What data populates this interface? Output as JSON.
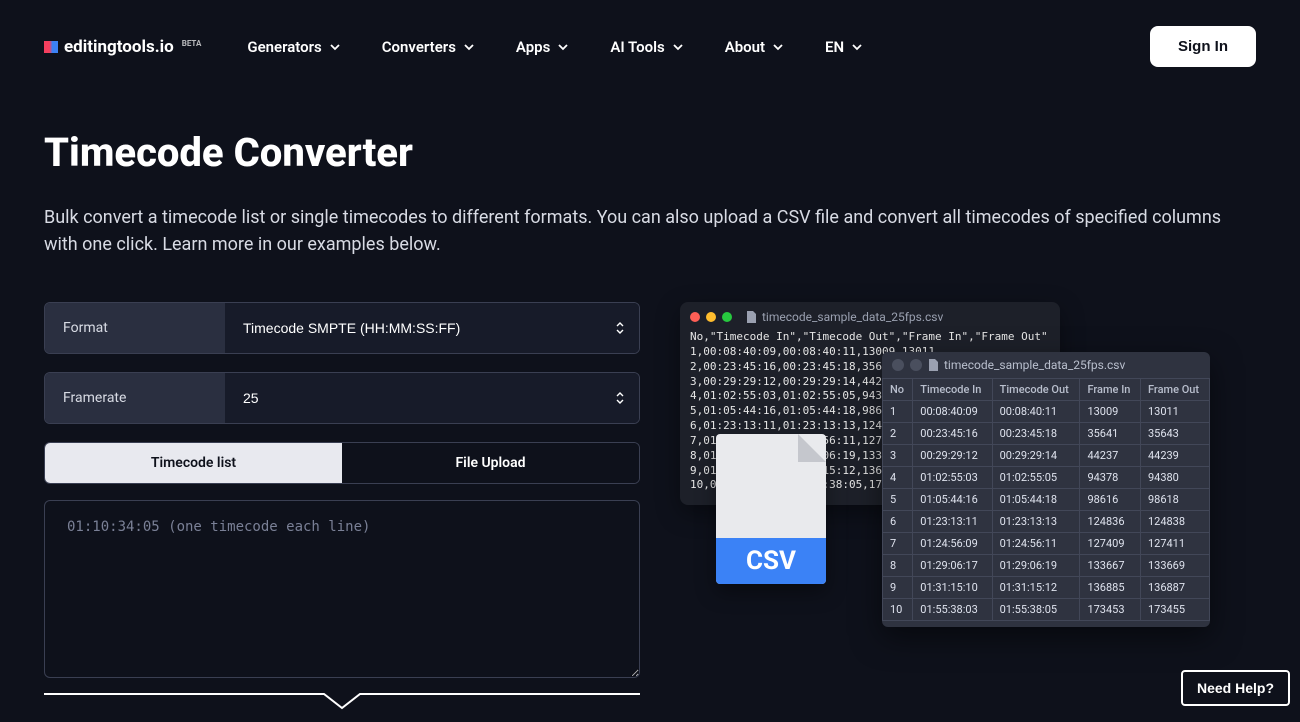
{
  "brand": {
    "name": "editingtools.io",
    "badge": "BETA"
  },
  "nav": {
    "items": [
      "Generators",
      "Converters",
      "Apps",
      "AI Tools",
      "About",
      "EN"
    ]
  },
  "auth": {
    "signin": "Sign In"
  },
  "page": {
    "title": "Timecode Converter",
    "description": "Bulk convert a timecode list or single timecodes to different formats. You can also upload a CSV file and convert all timecodes of specified columns with one click. Learn more in our examples below."
  },
  "form": {
    "format_label": "Format",
    "format_value": "Timecode SMPTE (HH:MM:SS:FF)",
    "framerate_label": "Framerate",
    "framerate_value": "25",
    "tabs": {
      "list": "Timecode list",
      "upload": "File Upload"
    },
    "textarea_placeholder": "01:10:34:05 (one timecode each line)"
  },
  "terminal": {
    "filename": "timecode_sample_data_25fps.csv",
    "content": "No,\"Timecode In\",\"Timecode Out\",\"Frame In\",\"Frame Out\"\n1,00:08:40:09,00:08:40:11,13009,13011\n2,00:23:45:16,00:23:45:18,35641,35643\n3,00:29:29:12,00:29:29:14,44237,44239\n4,01:02:55:03,01:02:55:05,94378,94380\n5,01:05:44:16,01:05:44:18,98616,98618\n6,01:23:13:11,01:23:13:13,124836\n7,01:24:56:09,01:24:56:11,127409\n8,01:29:06:17,01:29:06:19,133667\n9,01:31:15:10,01:31:15:12,136885\n10,01:55:38:03,01:55:38:05,173453"
  },
  "csv_icon": {
    "label": "CSV"
  },
  "table": {
    "filename": "timecode_sample_data_25fps.csv",
    "headers": [
      "No",
      "Timecode In",
      "Timecode Out",
      "Frame In",
      "Frame Out"
    ],
    "rows": [
      [
        "1",
        "00:08:40:09",
        "00:08:40:11",
        "13009",
        "13011"
      ],
      [
        "2",
        "00:23:45:16",
        "00:23:45:18",
        "35641",
        "35643"
      ],
      [
        "3",
        "00:29:29:12",
        "00:29:29:14",
        "44237",
        "44239"
      ],
      [
        "4",
        "01:02:55:03",
        "01:02:55:05",
        "94378",
        "94380"
      ],
      [
        "5",
        "01:05:44:16",
        "01:05:44:18",
        "98616",
        "98618"
      ],
      [
        "6",
        "01:23:13:11",
        "01:23:13:13",
        "124836",
        "124838"
      ],
      [
        "7",
        "01:24:56:09",
        "01:24:56:11",
        "127409",
        "127411"
      ],
      [
        "8",
        "01:29:06:17",
        "01:29:06:19",
        "133667",
        "133669"
      ],
      [
        "9",
        "01:31:15:10",
        "01:31:15:12",
        "136885",
        "136887"
      ],
      [
        "10",
        "01:55:38:03",
        "01:55:38:05",
        "173453",
        "173455"
      ]
    ]
  },
  "help": {
    "label": "Need Help?"
  }
}
